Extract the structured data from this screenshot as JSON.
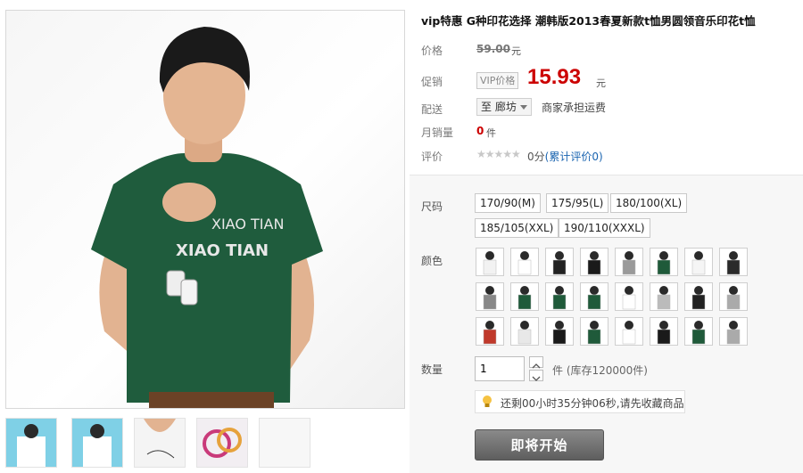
{
  "product": {
    "title": "vip特惠 G种印花选择 潮韩版2013春夏新款t恤男圆领音乐印花t恤",
    "labels": {
      "price": "价格",
      "promo": "促销",
      "shipping": "配送",
      "monthly_sales": "月销量",
      "rating": "评价",
      "size": "尺码",
      "color": "颜色",
      "quantity": "数量"
    },
    "original_price": "59.00",
    "currency_unit": "元",
    "vip_tag": "VIP价格",
    "promo_price": "15.93",
    "shipping_to": "至 廊坊",
    "shipping_note": "商家承担运费",
    "monthly_sales": "0",
    "sales_unit": "件",
    "rating_stars": "★★★★★",
    "rating_score": "0分",
    "rating_link": "(累计评价0)",
    "tshirt_print": [
      "XIAO TIAN",
      "XIAO TIAN"
    ]
  },
  "sizes": [
    "170/90(M)",
    "175/95(L)",
    "180/100(XL)",
    "185/105(XXL)",
    "190/110(XXXL)"
  ],
  "color_swatches": [
    "#f2f2f2",
    "#ffffff",
    "#222222",
    "#1a1a1a",
    "#9a9a9a",
    "#1f5a3a",
    "#f5f5f5",
    "#2a2a2a",
    "#888888",
    "#1f5a3a",
    "#1f5a3a",
    "#1f5a3a",
    "#ffffff",
    "#bbbbbb",
    "#222222",
    "#aaaaaa",
    "#c0392b",
    "#e8e8e8",
    "#1a1a1a",
    "#1f5a3a",
    "#ffffff",
    "#1a1a1a",
    "#1f5a3a",
    "#aaaaaa"
  ],
  "quantity": {
    "value": "1",
    "note": "件 (库存120000件)"
  },
  "countdown_tip": "还剩00小时35分钟06秒,请先收藏商品",
  "cta_label": "即将开始",
  "thumbnails": [
    "#7fd0e6",
    "#7fd0e6",
    "#f4f4f4",
    "#f2eef2",
    "#f7f7f7"
  ]
}
